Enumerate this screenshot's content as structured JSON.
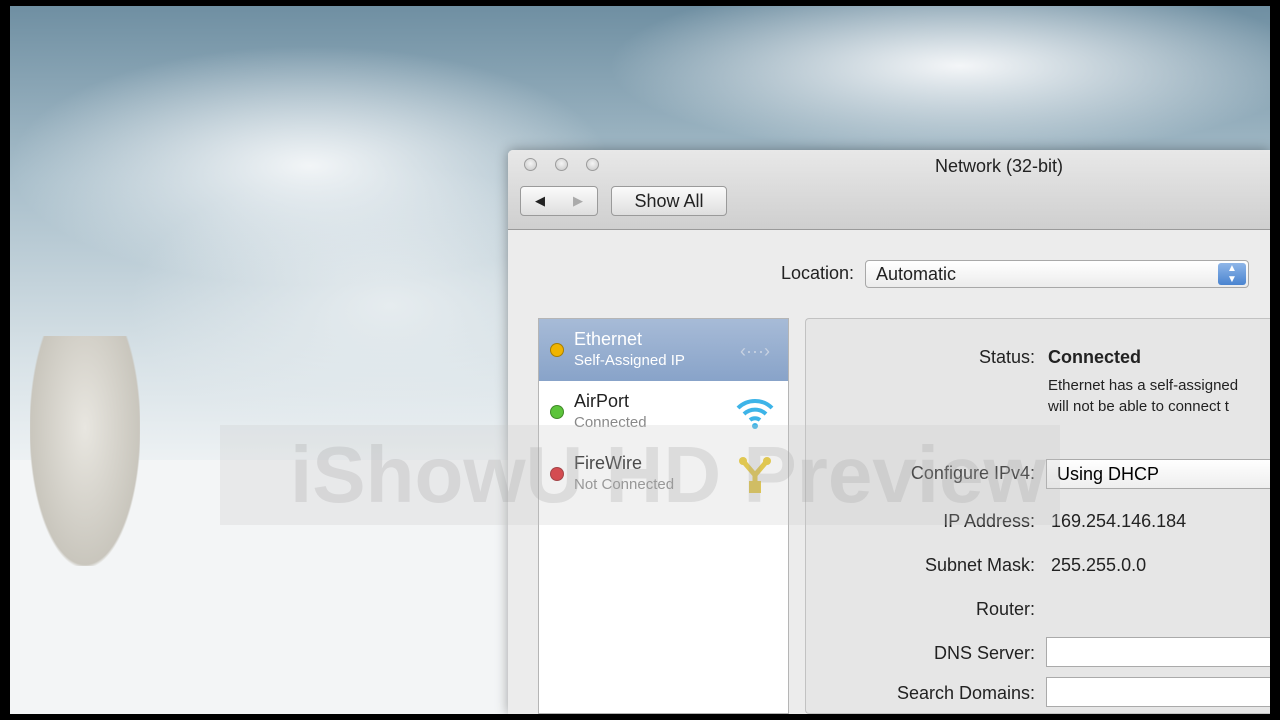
{
  "window": {
    "title": "Network (32-bit)",
    "show_all": "Show All",
    "back_icon": "◀",
    "forward_icon": "▶"
  },
  "location": {
    "label": "Location:",
    "value": "Automatic"
  },
  "services": [
    {
      "name": "Ethernet",
      "status": "Self-Assigned IP",
      "color": "#f0b400",
      "icon": "‹···›"
    },
    {
      "name": "AirPort",
      "status": "Connected",
      "color": "#5cc43a",
      "icon": "wifi"
    },
    {
      "name": "FireWire",
      "status": "Not Connected",
      "color": "#d8232a",
      "icon": "firewire"
    }
  ],
  "detail": {
    "status_label": "Status:",
    "status_value": "Connected",
    "status_desc_1": "Ethernet has a self-assigned",
    "status_desc_2": "will not be able to connect t",
    "configure_label": "Configure IPv4:",
    "configure_value": "Using DHCP",
    "ip_label": "IP Address:",
    "ip_value": "169.254.146.184",
    "subnet_label": "Subnet Mask:",
    "subnet_value": "255.255.0.0",
    "router_label": "Router:",
    "dns_label": "DNS Server:",
    "search_label": "Search Domains:"
  },
  "watermark": "iShowU HD Preview"
}
